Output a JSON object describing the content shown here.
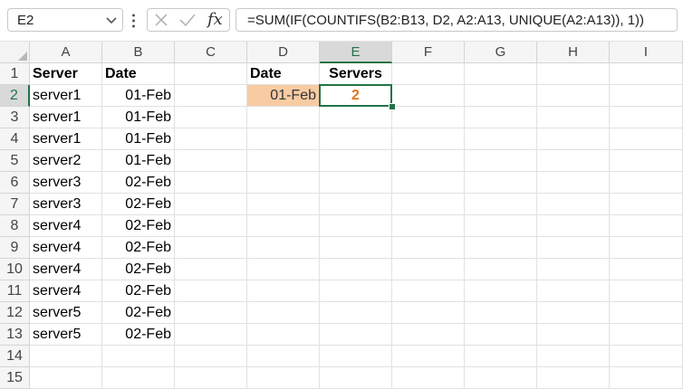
{
  "namebox": {
    "value": "E2"
  },
  "formula_bar": {
    "fx_label": "fx",
    "formula": "=SUM(IF(COUNTIFS(B2:B13, D2, A2:A13, UNIQUE(A2:A13)), 1))"
  },
  "columns": [
    "A",
    "B",
    "C",
    "D",
    "E",
    "F",
    "G",
    "H",
    "I"
  ],
  "rows": [
    "1",
    "2",
    "3",
    "4",
    "5",
    "6",
    "7",
    "8",
    "9",
    "10",
    "11",
    "12",
    "13",
    "14",
    "15"
  ],
  "cells": {
    "A1": "Server",
    "B1": "Date",
    "A2": "server1",
    "B2": "01-Feb",
    "A3": "server1",
    "B3": "01-Feb",
    "A4": "server1",
    "B4": "01-Feb",
    "A5": "server2",
    "B5": "01-Feb",
    "A6": "server3",
    "B6": "02-Feb",
    "A7": "server3",
    "B7": "02-Feb",
    "A8": "server4",
    "B8": "02-Feb",
    "A9": "server4",
    "B9": "02-Feb",
    "A10": "server4",
    "B10": "02-Feb",
    "A11": "server4",
    "B11": "02-Feb",
    "A12": "server5",
    "B12": "02-Feb",
    "A13": "server5",
    "B13": "02-Feb",
    "D1": "Date",
    "E1": "Servers",
    "D2": "01-Feb",
    "E2": "2"
  },
  "selected_cell": "E2",
  "colors": {
    "selection": "#217346",
    "date_fill": "#f8cba3",
    "result_text": "#e0741b"
  }
}
